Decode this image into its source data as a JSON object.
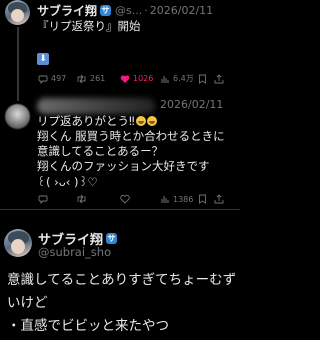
{
  "tweet1": {
    "display_name": "サブライ翔",
    "badge": "サ",
    "handle": "@s...",
    "date": "2026/02/11",
    "text": "『リプ返祭り』開始",
    "stats": {
      "replies": "497",
      "retweets": "261",
      "likes": "1026",
      "views": "6.4万"
    }
  },
  "tweet2": {
    "date": "2026/02/11",
    "line1": "リプ返ありがとう‼",
    "line2": "翔くん 服買う時とか合わせるときに",
    "line3": "意識してることあるー？",
    "line4": "翔くんのファッション大好きです",
    "line5": "꒰( ›ᴗ‹ )꒱♡",
    "stats": {
      "views": "1386"
    }
  },
  "main": {
    "display_name": "サブライ翔",
    "badge": "サ",
    "handle": "@subrai_sho",
    "line1": "意識してることありすぎてちょーむず",
    "line2": "いけど",
    "line3": "・直感でビビッと来たやつ"
  },
  "icons": {
    "reply": "reply-icon",
    "retweet": "retweet-icon",
    "like": "heart-icon",
    "views": "views-icon",
    "bookmark": "bookmark-icon",
    "share": "share-icon",
    "download": "down-arrow-icon"
  },
  "colors": {
    "accent": "#1d9bf0",
    "like": "#f91880",
    "badge": "#2f86d6"
  }
}
